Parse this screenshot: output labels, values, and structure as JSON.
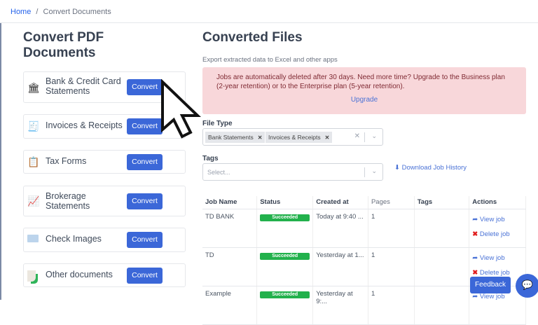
{
  "breadcrumb": {
    "home": "Home",
    "separator": "/",
    "current": "Convert Documents"
  },
  "left": {
    "title": "Convert PDF Documents",
    "cards": [
      {
        "label": "Bank & Credit Card Statements",
        "icon": "bank-icon",
        "button": "Convert"
      },
      {
        "label": "Invoices & Receipts",
        "icon": "invoice-icon",
        "button": "Convert"
      },
      {
        "label": "Tax Forms",
        "icon": "tax-form-icon",
        "button": "Convert"
      },
      {
        "label": "Brokerage Statements",
        "icon": "brokerage-icon",
        "button": "Convert"
      },
      {
        "label": "Check Images",
        "icon": "check-icon",
        "button": "Convert"
      },
      {
        "label": "Other documents",
        "icon": "document-icon",
        "button": "Convert"
      }
    ]
  },
  "right": {
    "title": "Converted Files",
    "subtitle": "Export extracted data to Excel and other apps",
    "alert": {
      "text": "Jobs are automatically deleted after 30 days. Need more time? Upgrade to the Business plan (2-year retention) or to the Enterprise plan (5-year retention).",
      "link": "Upgrade"
    },
    "file_type": {
      "label": "File Type",
      "chips": [
        "Bank Statements",
        "Invoices & Receipts"
      ]
    },
    "tags": {
      "label": "Tags",
      "placeholder": "Select..."
    },
    "download": "Download Job History",
    "table": {
      "headers": [
        "Job Name",
        "Status",
        "Created at",
        "Pages",
        "Tags",
        "Actions"
      ],
      "rows": [
        {
          "name": "TD BANK",
          "status": "Succeeded",
          "created": "Today at 9:40 ...",
          "pages": "1",
          "tags": "",
          "view": "View job",
          "delete": "Delete job"
        },
        {
          "name": "TD",
          "status": "Succeeded",
          "created": "Yesterday at 1...",
          "pages": "1",
          "tags": "",
          "view": "View job",
          "delete": "Delete job"
        },
        {
          "name": "Example",
          "status": "Succeeded",
          "created": "Yesterday at 9:...",
          "pages": "1",
          "tags": "",
          "view": "View job",
          "delete": ""
        }
      ]
    }
  },
  "feedback": "Feedback",
  "colors": {
    "primary": "#3b67d8",
    "alert_bg": "#f8d7da",
    "success": "#22b14c",
    "danger": "#e11d1d"
  }
}
